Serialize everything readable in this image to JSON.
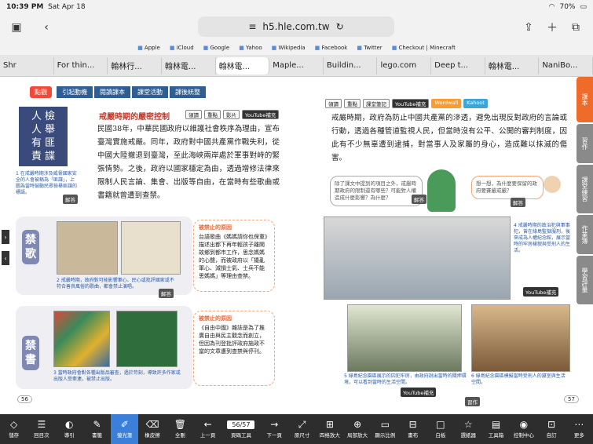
{
  "status": {
    "time": "10:39 PM",
    "date": "Sat Apr 18",
    "battery": "70%"
  },
  "url": "h5.hle.com.tw",
  "bookmarks": [
    "Apple",
    "iCloud",
    "Google",
    "Yahoo",
    "Wikipedia",
    "Facebook",
    "Twitter",
    "Checkout | Minecraft"
  ],
  "tabs": [
    "Shr",
    "For thin...",
    "翰林行...",
    "翰林電...",
    "翰林電...",
    "Maple...",
    "Buildin...",
    "lego.com",
    "Deep t...",
    "翰林電...",
    "NaniBo..."
  ],
  "left": {
    "tag": "點觀",
    "nav": [
      "引起動機",
      "閱讀課本",
      "課堂活動",
      "課後統整"
    ],
    "stamp": [
      "檢",
      "舉",
      "匪",
      "諜",
      "人",
      "人",
      "有",
      "責"
    ],
    "stamp_caption": "1 在戒嚴時期涉及威脅國家安全的人會被稱為「匪諜」，上圖為當時鼓勵民眾檢舉匪諜的標語。",
    "stamp_answer": "解答",
    "heading": "戒嚴時期的嚴密控制",
    "chips": [
      "領讀",
      "重點",
      "影片",
      "YouTube補充"
    ],
    "paragraph": "民國38年，中華民國政府以維護社會秩序為理由，宣布臺灣實施戒嚴。同年，政府對中國共產黨作戰失利，從中國大陸撤退到臺灣，至此海峽兩岸處於軍事對峙的緊張情勢。之後，政府以國家穩定為由，透過增修法律來限制人民言論、集會、出版等自由，在當時有些歌曲或書籍就曾遭到查禁。",
    "song_label": "禁歌",
    "book_label": "禁書",
    "song_caption": "2 戒嚴時期，政府對可能影響軍心、民心或批評國家或不符合善良風俗的歌曲，都會禁止演唱。",
    "book_caption": "3 當時政府會對各種出版品審查，過於苛刻，導致許多作家或出版人受牽連，被禁止出版。",
    "answer": "解答",
    "reason_title": "被禁止的原因",
    "reason1": "台語歌曲《媽媽請你也保重》描述出都下再年輕孩子離開故鄉到都市工作，思念媽媽的心聲，而被政府以「擾亂軍心、減損士氣、士兵不能思媽媽」等理由查禁。",
    "reason2": "《自由中國》雜誌是為了推廣自由與民主觀念而創立，但因為刊登批評政府施政不當的文章遭到查禁與停刊。",
    "page": "56"
  },
  "right": {
    "chips": [
      "領讀",
      "重點",
      "課堂筆記",
      "YouTube補充",
      "Wordwall",
      "Kahoot"
    ],
    "paragraph": "戒嚴時期，政府為防止中國共產黨的滲透，避免出現反對政府的言論或行動，透過各種管道監視人民，但當時沒有公平、公開的審判制度，因此有不少無辜遭到逮捕，對當事人及家屬的身心，造成難以抹滅的傷害。",
    "bubble1": "除了課文中提到的項目之外，戒嚴時期政府的限制還有哪些？可能對人權造成什麼影響？為什麼？",
    "bubble2": "想一想，為什麼要保留的政府要賽嚴戒嚴？",
    "photo_caption4": "4 戒嚴時期的政治犯與軍事犯，曾在綠島監獄服刑，後來成為人權紀念館，展示當時的牢房樣貌與受刑人的生活。",
    "photo_caption5": "5 綠島紀念園區展示的囚犯牢房，由政府說出當時的關押環境，可以看到當時的生活空間。",
    "photo_caption6": "6 綠島紀念園區模擬當時受刑人的寢室與生活空間。",
    "youtube": "YouTube補充",
    "answer": "解答",
    "exercise": "習作",
    "page": "57",
    "side": [
      "課本",
      "習作",
      "課堂練習",
      "作業簿",
      "學習評量"
    ]
  },
  "toolbar": [
    "儲存",
    "回目次",
    "導引",
    "書籤",
    "螢光筆",
    "橡皮擦",
    "全刪",
    "上一頁",
    "頁碼工具",
    "下一頁",
    "原尺寸",
    "四格放大",
    "局部放大",
    "顯示比例",
    "畫布",
    "白板",
    "選紙器",
    "工具箱",
    "控制中心",
    "自訂",
    "更多"
  ],
  "pagebox": "56/57"
}
